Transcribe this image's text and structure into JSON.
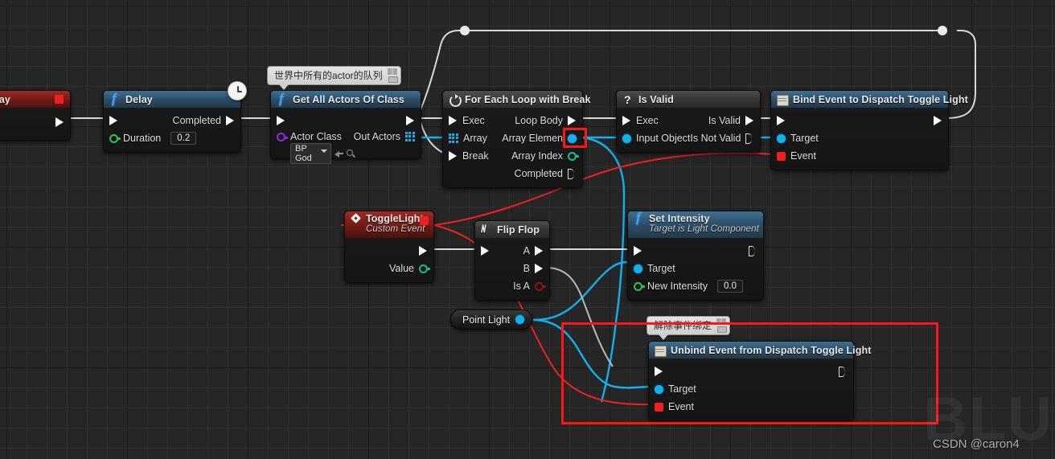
{
  "graph": {
    "background": "#262626",
    "accent_red": "#fb1717",
    "wire_exec": "#d8d8d8",
    "wire_object": "#12b0f0",
    "wire_delegate": "#ef2020"
  },
  "nodes": {
    "event_begin_play": {
      "title": "nt BeginPlay",
      "icon": "event-node-icon",
      "out_exec": "",
      "delegate_pin": "delegate-output-pin"
    },
    "delay": {
      "title": "Delay",
      "icon": "function-f-icon",
      "badge": "clock-icon",
      "in_exec": "",
      "out_exec_label": "Completed",
      "duration_label": "Duration",
      "duration_value": "0.2"
    },
    "get_all_actors": {
      "title": "Get All Actors Of Class",
      "icon": "function-f-icon",
      "actor_class_label": "Actor Class",
      "actor_class_value": "BP God",
      "out_actors_label": "Out Actors",
      "comment": "世界中所有的actor的队列"
    },
    "for_each_loop": {
      "title": "For Each Loop with Break",
      "icon": "loop-icon",
      "exec_label": "Exec",
      "array_label": "Array",
      "break_label": "Break",
      "loop_body_label": "Loop Body",
      "array_element_label": "Array Elemen",
      "array_index_label": "Array Index",
      "completed_label": "Completed"
    },
    "is_valid": {
      "title": "Is Valid",
      "icon": "question-mark-icon",
      "exec_label": "Exec",
      "input_object_label": "Input Object",
      "is_valid_label": "Is Valid",
      "is_not_valid_label": "Is Not Valid"
    },
    "bind_event": {
      "title": "Bind Event to Dispatch Toggle Light",
      "icon": "bind-event-icon",
      "target_label": "Target",
      "event_label": "Event"
    },
    "toggle_light": {
      "title": "ToggleLight",
      "subtitle": "Custom Event",
      "icon": "custom-event-icon",
      "value_label": "Value"
    },
    "flip_flop": {
      "title": "Flip Flop",
      "icon": "flipflop-icon",
      "a_label": "A",
      "b_label": "B",
      "is_a_label": "Is A"
    },
    "set_intensity": {
      "title": "Set Intensity",
      "subtitle": "Target is Light Component",
      "icon": "function-f-icon",
      "target_label": "Target",
      "new_intensity_label": "New Intensity",
      "new_intensity_value": "0.0"
    },
    "point_light": {
      "title": "Point Light",
      "icon": "object-pin-icon"
    },
    "unbind_event": {
      "title": "Unbind Event from Dispatch Toggle Light",
      "icon": "bind-event-icon",
      "target_label": "Target",
      "event_label": "Event",
      "comment": "解除事件绑定"
    }
  },
  "watermark": {
    "big": "BLUE",
    "small": "CSDN @caron4"
  }
}
